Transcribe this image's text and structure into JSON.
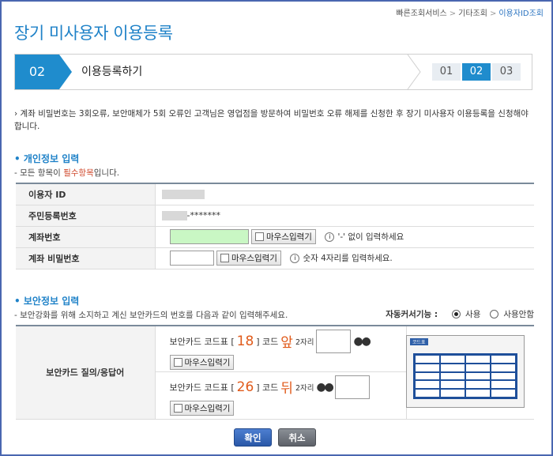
{
  "breadcrumb": [
    "빠른조회서비스",
    "기타조회",
    "이용자ID조회"
  ],
  "page_title": "장기 미사용자 이용등록",
  "stepbar": {
    "current_num": "02",
    "current_label": "이용등록하기",
    "steps": [
      "01",
      "02",
      "03"
    ]
  },
  "notice": "계좌 비밀번호는 3회오류, 보안매체가 5회 오류인 고객님은 영업점을 방문하여 비밀번호 오류 해제를 신청한 후 장기 미사용자 이용등록을 신청해야 합니다.",
  "personal": {
    "title": "개인정보 입력",
    "sub_prefix": "- 모든 항목이 ",
    "sub_req": "필수항목",
    "sub_suffix": "입니다.",
    "rows": {
      "user_id": "이용자 ID",
      "rrn": "주민등록번호",
      "rrn_value": "-*******",
      "account": "계좌번호",
      "account_hint": "'-' 없이 입력하세요",
      "password": "계좌 비밀번호",
      "password_hint": "숫자 4자리를 입력하세요."
    },
    "mouse_input": "마우스입력기"
  },
  "security": {
    "title": "보안정보 입력",
    "sub": "- 보안강화를 위해 소지하고 계신 보안카드의 번호를 다음과 같이 입력해주세요.",
    "auto_cursor_label": "자동커서기능 :",
    "auto_on": "사용",
    "auto_off": "사용안함",
    "row_label": "보안카드 질의/응답어",
    "q1": {
      "prefix": "보안카드 코드표 [",
      "num": "18",
      "mid": "] 코드",
      "pos": "앞",
      "digits": "2자리"
    },
    "q2": {
      "prefix": "보안카드 코드표 [",
      "num": "26",
      "mid": "] 코드",
      "pos": "뒤",
      "digits": "2자리"
    },
    "mouse_input": "마우스입력기",
    "card_title": "코드표"
  },
  "buttons": {
    "ok": "확인",
    "cancel": "취소"
  }
}
